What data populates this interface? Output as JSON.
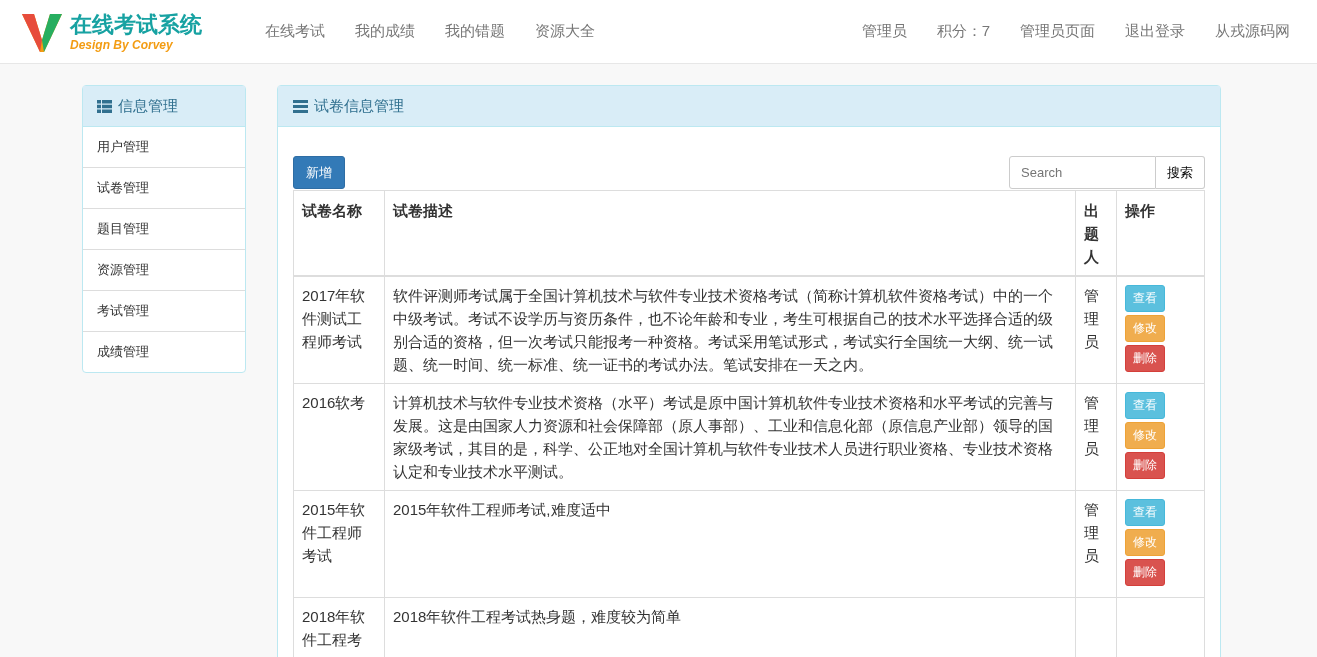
{
  "brand": {
    "title": "在线考试系统",
    "subtitle": "Design By Corvey"
  },
  "nav": {
    "left": [
      "在线考试",
      "我的成绩",
      "我的错题",
      "资源大全"
    ],
    "right": [
      "管理员",
      "积分：7",
      "管理员页面",
      "退出登录",
      "从戎源码网"
    ]
  },
  "sidebar": {
    "title": "信息管理",
    "items": [
      "用户管理",
      "试卷管理",
      "题目管理",
      "资源管理",
      "考试管理",
      "成绩管理"
    ]
  },
  "panel": {
    "title": "试卷信息管理",
    "add_button": "新增",
    "search": {
      "placeholder": "Search",
      "button": "搜索"
    }
  },
  "table": {
    "columns": [
      "试卷名称",
      "试卷描述",
      "出题人",
      "操作"
    ],
    "rows": [
      {
        "name": "2017年软件测试工程师考试",
        "description": "软件评测师考试属于全国计算机技术与软件专业技术资格考试（简称计算机软件资格考试）中的一个中级考试。考试不设学历与资历条件，也不论年龄和专业，考生可根据自己的技术水平选择合适的级别合适的资格，但一次考试只能报考一种资格。考试采用笔试形式，考试实行全国统一大纲、统一试题、统一时间、统一标准、统一证书的考试办法。笔试安排在一天之内。",
        "author": "管理员",
        "actions": [
          {
            "kind": "view",
            "label": "查看"
          },
          {
            "kind": "edit",
            "label": "修改"
          },
          {
            "kind": "delete",
            "label": "删除"
          }
        ]
      },
      {
        "name": "2016软考",
        "description": "计算机技术与软件专业技术资格（水平）考试是原中国计算机软件专业技术资格和水平考试的完善与发展。这是由国家人力资源和社会保障部（原人事部）、工业和信息化部（原信息产业部）领导的国家级考试，其目的是，科学、公正地对全国计算机与软件专业技术人员进行职业资格、专业技术资格认定和专业技术水平测试。",
        "author": "管理员",
        "actions": [
          {
            "kind": "view",
            "label": "查看"
          },
          {
            "kind": "edit",
            "label": "修改"
          },
          {
            "kind": "delete",
            "label": "删除"
          }
        ]
      },
      {
        "name": "2015年软件工程师考试",
        "description": "2015年软件工程师考试,难度适中",
        "author": "管理员",
        "actions": [
          {
            "kind": "view",
            "label": "查看"
          },
          {
            "kind": "edit",
            "label": "修改"
          },
          {
            "kind": "delete",
            "label": "删除"
          }
        ]
      },
      {
        "name": "2018年软件工程考",
        "description": "2018年软件工程考试热身题，难度较为简单"
      }
    ]
  }
}
